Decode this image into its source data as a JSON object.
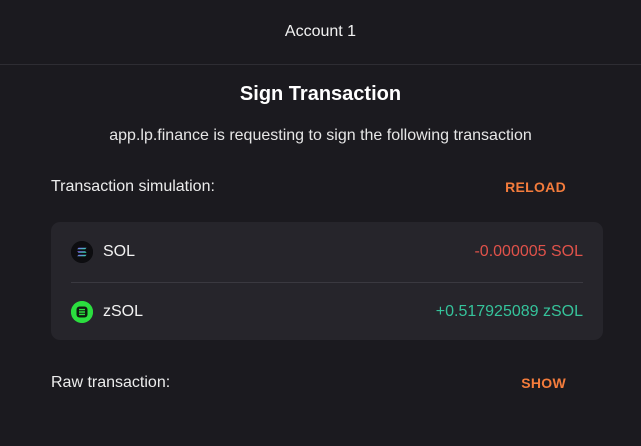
{
  "header": {
    "account_label": "Account 1"
  },
  "page": {
    "title": "Sign Transaction",
    "request_text": "app.lp.finance is requesting to sign the following transaction"
  },
  "simulation": {
    "label": "Transaction simulation:",
    "reload_label": "RELOAD",
    "rows": [
      {
        "token": "SOL",
        "amount": "-0.000005 SOL",
        "icon": "solana-logo-icon",
        "direction": "negative"
      },
      {
        "token": "zSOL",
        "amount": "+0.517925089 zSOL",
        "icon": "zsol-logo-icon",
        "direction": "positive"
      }
    ]
  },
  "raw": {
    "label": "Raw transaction:",
    "show_label": "SHOW"
  },
  "colors": {
    "background": "#1b1a1f",
    "card": "#26252b",
    "accent": "#f47c3c",
    "negative": "#e0524a",
    "positive": "#35c39b"
  }
}
